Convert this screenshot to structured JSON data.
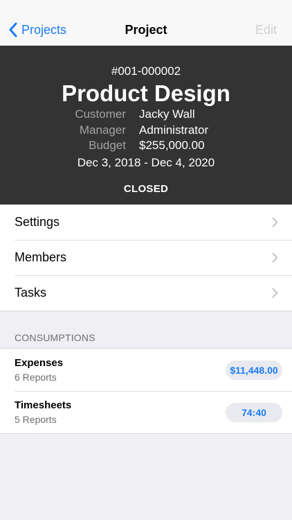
{
  "nav": {
    "back_label": "Projects",
    "title": "Project",
    "edit_label": "Edit"
  },
  "project": {
    "code": "#001-000002",
    "name": "Product Design",
    "info": [
      {
        "label": "Customer",
        "value": "Jacky Wall"
      },
      {
        "label": "Manager",
        "value": "Administrator"
      },
      {
        "label": "Budget",
        "value": "$255,000.00"
      }
    ],
    "dates": "Dec 3, 2018 - Dec 4, 2020",
    "status": "CLOSED"
  },
  "menu": {
    "items": [
      {
        "label": "Settings"
      },
      {
        "label": "Members"
      },
      {
        "label": "Tasks"
      }
    ]
  },
  "consumptions": {
    "header": "CONSUMPTIONS",
    "rows": [
      {
        "title": "Expenses",
        "subtitle": "6 Reports",
        "value": "$11,448.00"
      },
      {
        "title": "Timesheets",
        "subtitle": "5 Reports",
        "value": "74:40"
      }
    ]
  },
  "colors": {
    "accent": "#1a7cf5",
    "header_bg": "#333333",
    "page_bg": "#efeff4",
    "pill_bg": "#e9eaef"
  }
}
